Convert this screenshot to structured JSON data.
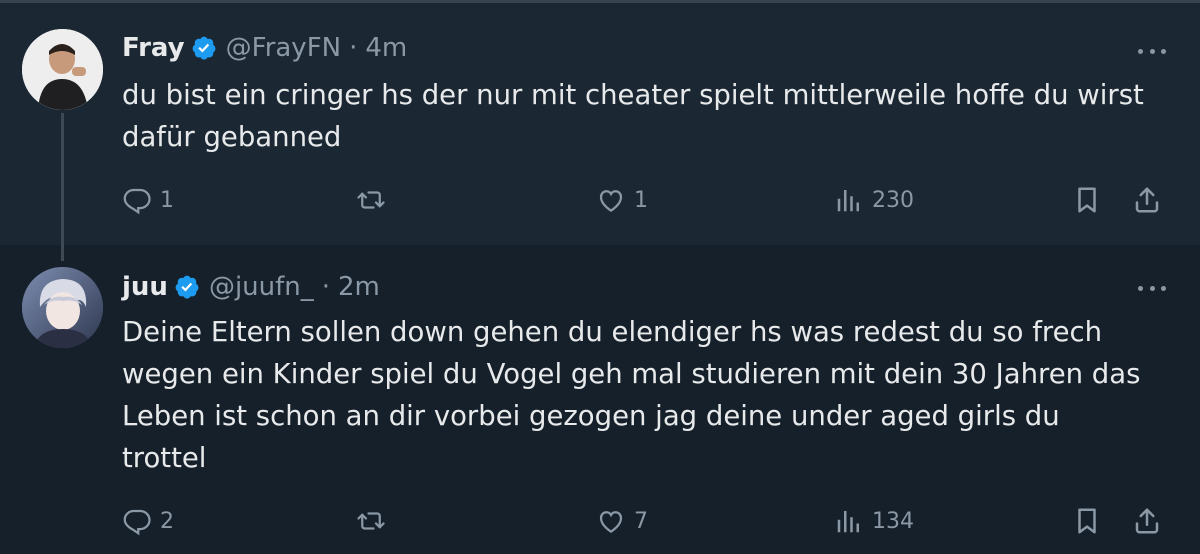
{
  "colors": {
    "background": "#15202b",
    "highlighted_background": "#1b2834",
    "text_primary": "#e7e9ea",
    "text_secondary": "#8b98a5",
    "verified_badge": "#1d9bf0"
  },
  "tweets": [
    {
      "display_name": "Fray",
      "verified": true,
      "handle": "@FrayFN",
      "separator": "·",
      "time": "4m",
      "text": "du bist ein cringer hs der nur mit cheater spielt mittlerweile hoffe du wirst\ndafür gebanned",
      "replies": "1",
      "retweets": "",
      "likes": "1",
      "views": "230"
    },
    {
      "display_name": "juu",
      "verified": true,
      "handle": "@juufn_",
      "separator": "·",
      "time": "2m",
      "text": "Deine Eltern sollen down gehen du elendiger hs was redest du so frech\nwegen ein Kinder spiel du Vogel geh mal studieren mit dein 30 Jahren das\nLeben ist schon an dir vorbei gezogen jag deine under aged girls du\ntrottel",
      "replies": "2",
      "retweets": "",
      "likes": "7",
      "views": "134"
    }
  ],
  "icons": {
    "more": "more-horizontal-icon",
    "reply": "reply-icon",
    "retweet": "retweet-icon",
    "like": "heart-icon",
    "views": "views-chart-icon",
    "bookmark": "bookmark-icon",
    "share": "share-icon",
    "verified": "verified-badge-icon"
  }
}
